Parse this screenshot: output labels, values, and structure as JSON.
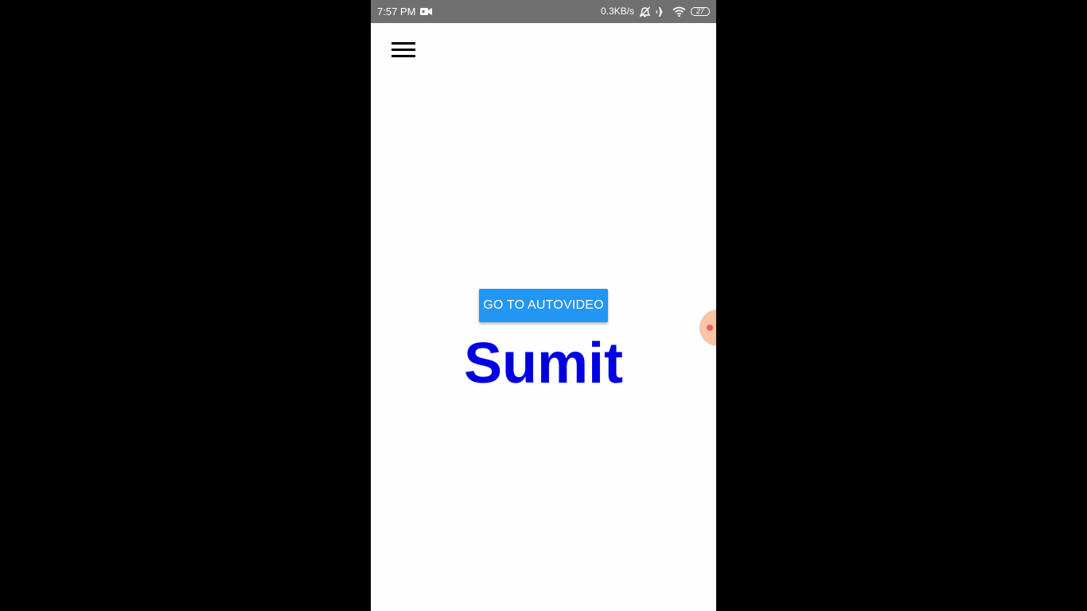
{
  "status_bar": {
    "time": "7:57 PM",
    "network_speed": "0.3KB/s",
    "battery_level": "27",
    "icons": [
      "video-record-icon",
      "alarm-off-icon",
      "airplane-icon",
      "wifi-icon",
      "battery-icon"
    ]
  },
  "app": {
    "menu_icon": "hamburger-menu-icon",
    "button_label": "GO TO AUTOVIDEO",
    "button_color": "#2396f3",
    "name_text": "Sumit",
    "name_color": "#0000e0"
  },
  "colors": {
    "status_bar_bg": "#6f706f",
    "screen_bg": "#fdfefd",
    "bubble": "#fbc3a8",
    "bubble_dot": "#f25f5c"
  }
}
